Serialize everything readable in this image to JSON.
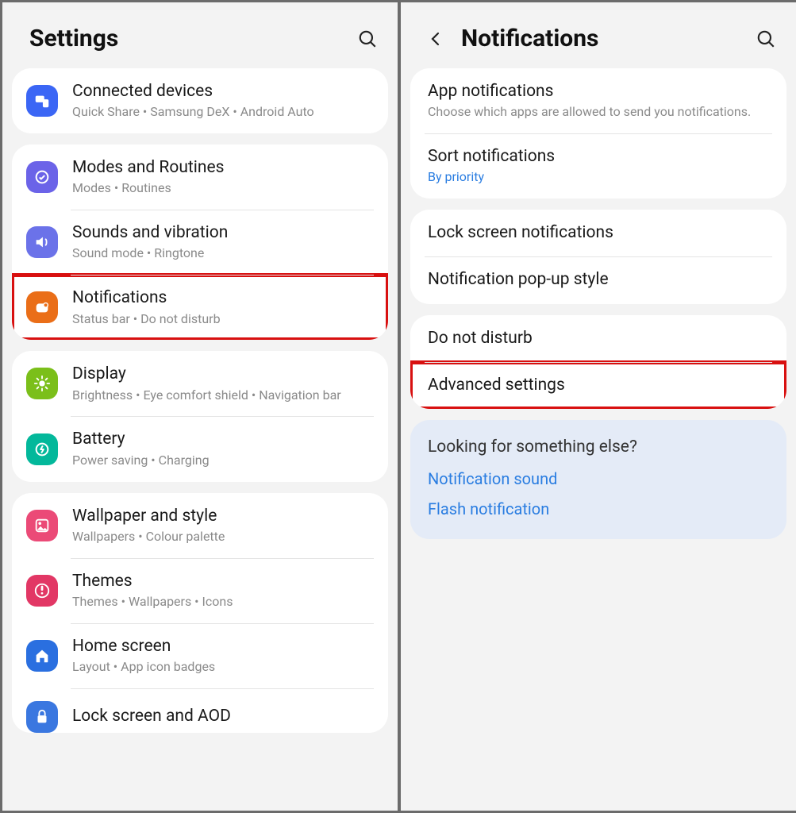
{
  "left": {
    "title": "Settings",
    "groups": [
      {
        "rows": [
          {
            "icon": "connected-devices",
            "label": "Connected devices",
            "sub": "Quick Share  •  Samsung DeX  •  Android Auto"
          }
        ]
      },
      {
        "rows": [
          {
            "icon": "modes",
            "label": "Modes and Routines",
            "sub": "Modes  •  Routines"
          },
          {
            "icon": "sound",
            "label": "Sounds and vibration",
            "sub": "Sound mode  •  Ringtone"
          },
          {
            "icon": "notifications",
            "label": "Notifications",
            "sub": "Status bar  •  Do not disturb",
            "highlight": true
          }
        ]
      },
      {
        "rows": [
          {
            "icon": "display",
            "label": "Display",
            "sub": "Brightness  •  Eye comfort shield  •  Navigation bar"
          },
          {
            "icon": "battery",
            "label": "Battery",
            "sub": "Power saving  •  Charging"
          }
        ]
      },
      {
        "rows": [
          {
            "icon": "wallpaper",
            "label": "Wallpaper and style",
            "sub": "Wallpapers  •  Colour palette"
          },
          {
            "icon": "themes",
            "label": "Themes",
            "sub": "Themes  •  Wallpapers  •  Icons"
          },
          {
            "icon": "home",
            "label": "Home screen",
            "sub": "Layout  •  App icon badges"
          },
          {
            "icon": "lock",
            "label": "Lock screen and AOD",
            "sub": ""
          }
        ]
      }
    ]
  },
  "right": {
    "title": "Notifications",
    "groups": [
      {
        "rows": [
          {
            "label": "App notifications",
            "sub": "Choose which apps are allowed to send you notifications."
          },
          {
            "label": "Sort notifications",
            "sub": "By priority",
            "subLink": true
          }
        ]
      },
      {
        "rows": [
          {
            "label": "Lock screen notifications"
          },
          {
            "label": "Notification pop-up style"
          }
        ]
      },
      {
        "rows": [
          {
            "label": "Do not disturb"
          },
          {
            "label": "Advanced settings",
            "highlight": true
          }
        ]
      }
    ],
    "info": {
      "heading": "Looking for something else?",
      "links": [
        "Notification sound",
        "Flash notification"
      ]
    }
  }
}
